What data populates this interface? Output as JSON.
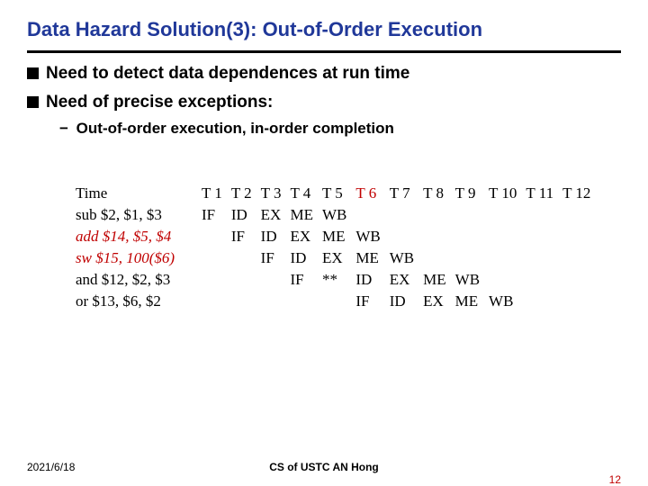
{
  "title": "Data Hazard Solution(3): Out-of-Order Execution",
  "bullets": {
    "b1": "Need to detect data dependences at run time",
    "b2": "Need of precise exceptions:",
    "b2a": "Out-of-order execution, in-order completion"
  },
  "footer": {
    "date": "2021/6/18",
    "center": "CS of USTC AN Hong",
    "page": "12"
  },
  "chart_data": {
    "type": "table",
    "title": "Pipeline timing diagram",
    "header_label": "Time",
    "columns": [
      "T 1",
      "T 2",
      "T 3",
      "T 4",
      "T 5",
      "T 6",
      "T 7",
      "T 8",
      "T 9",
      "T 10",
      "T 11",
      "T 12"
    ],
    "highlight_columns": [
      "T 6"
    ],
    "rows": [
      {
        "label": "sub $2, $1, $3",
        "italic_red": false,
        "cells": [
          "IF",
          "ID",
          "EX",
          "ME",
          "WB",
          "",
          "",
          "",
          "",
          "",
          "",
          ""
        ]
      },
      {
        "label": "add $14, $5, $4",
        "italic_red": true,
        "cells": [
          "",
          "IF",
          "ID",
          "EX",
          "ME",
          "WB",
          "",
          "",
          "",
          "",
          "",
          ""
        ]
      },
      {
        "label": "sw  $15, 100($6)",
        "italic_red": true,
        "cells": [
          "",
          "",
          "IF",
          "ID",
          "EX",
          "ME",
          "WB",
          "",
          "",
          "",
          "",
          ""
        ]
      },
      {
        "label": "and $12, $2, $3",
        "italic_red": false,
        "cells": [
          "",
          "",
          "",
          "IF",
          "**",
          "ID",
          "EX",
          "ME",
          "WB",
          "",
          "",
          ""
        ]
      },
      {
        "label": "or   $13, $6, $2",
        "italic_red": false,
        "cells": [
          "",
          "",
          "",
          "",
          "",
          "IF",
          "ID",
          "EX",
          "ME",
          "WB",
          "",
          ""
        ]
      }
    ]
  }
}
